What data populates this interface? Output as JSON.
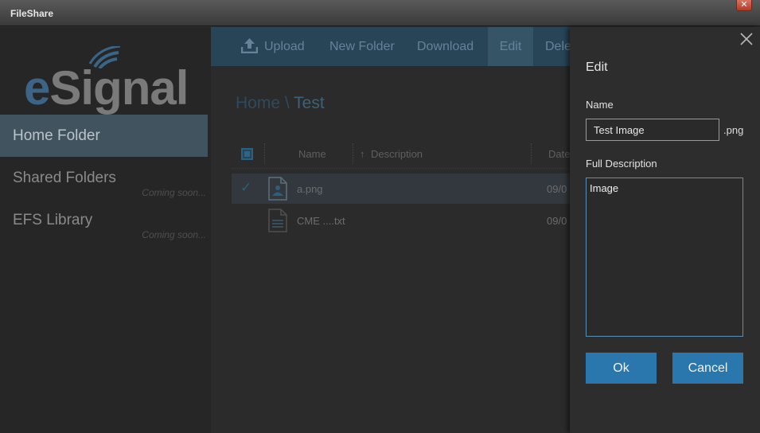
{
  "window": {
    "title": "FileShare",
    "close_glyph": "✕"
  },
  "sidebar": {
    "logo": "eSignal",
    "items": [
      {
        "label": "Home Folder",
        "note": ""
      },
      {
        "label": "Shared Folders",
        "note": "Coming soon..."
      },
      {
        "label": "EFS Library",
        "note": "Coming soon..."
      }
    ]
  },
  "toolbar": {
    "upload": "Upload",
    "new_folder": "New Folder",
    "download": "Download",
    "edit": "Edit",
    "delete": "Dele"
  },
  "breadcrumb": {
    "root": "Home",
    "separator": " \\ ",
    "current": "Test"
  },
  "table": {
    "columns": {
      "name": "Name",
      "description": "Description",
      "date": "Date"
    },
    "rows": [
      {
        "name": "a.png",
        "date": "09/0",
        "selected": true,
        "icon": "image-file-icon"
      },
      {
        "name": "CME ....txt",
        "date": "09/0",
        "selected": false,
        "icon": "text-file-icon"
      }
    ]
  },
  "edit_panel": {
    "title": "Edit",
    "name_label": "Name",
    "name_value": "Test Image",
    "extension": ".png",
    "description_label": "Full Description",
    "description_value": "Image",
    "ok": "Ok",
    "cancel": "Cancel"
  },
  "colors": {
    "accent": "#2a77ad",
    "sidebar_active": "#40535f",
    "toolbar": "#274556"
  }
}
